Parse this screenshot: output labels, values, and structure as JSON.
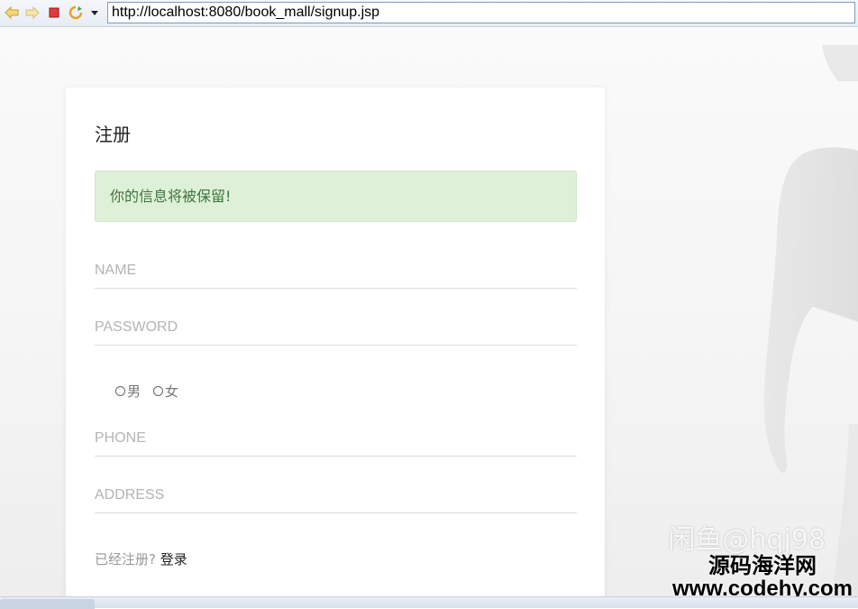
{
  "browser": {
    "url": "http://localhost:8080/book_mall/signup.jsp",
    "icons": [
      "back-icon",
      "forward-icon",
      "stop-icon",
      "refresh-icon",
      "dropdown-icon"
    ]
  },
  "signup": {
    "title": "注册",
    "alert": "你的信息将被保留!",
    "name_placeholder": "NAME",
    "password_placeholder": "PASSWORD",
    "gender_male": "男",
    "gender_female": "女",
    "phone_placeholder": "PHONE",
    "address_placeholder": "ADDRESS",
    "already_registered": "已经注册?",
    "login_link": "登录"
  },
  "watermark": {
    "faint": "闲鱼@hqj98",
    "main": "源码海洋网",
    "url": "www.codehy.com"
  },
  "colors": {
    "alert_bg": "#dff0d8",
    "alert_text": "#3c763d",
    "placeholder": "#b4b4b4"
  }
}
